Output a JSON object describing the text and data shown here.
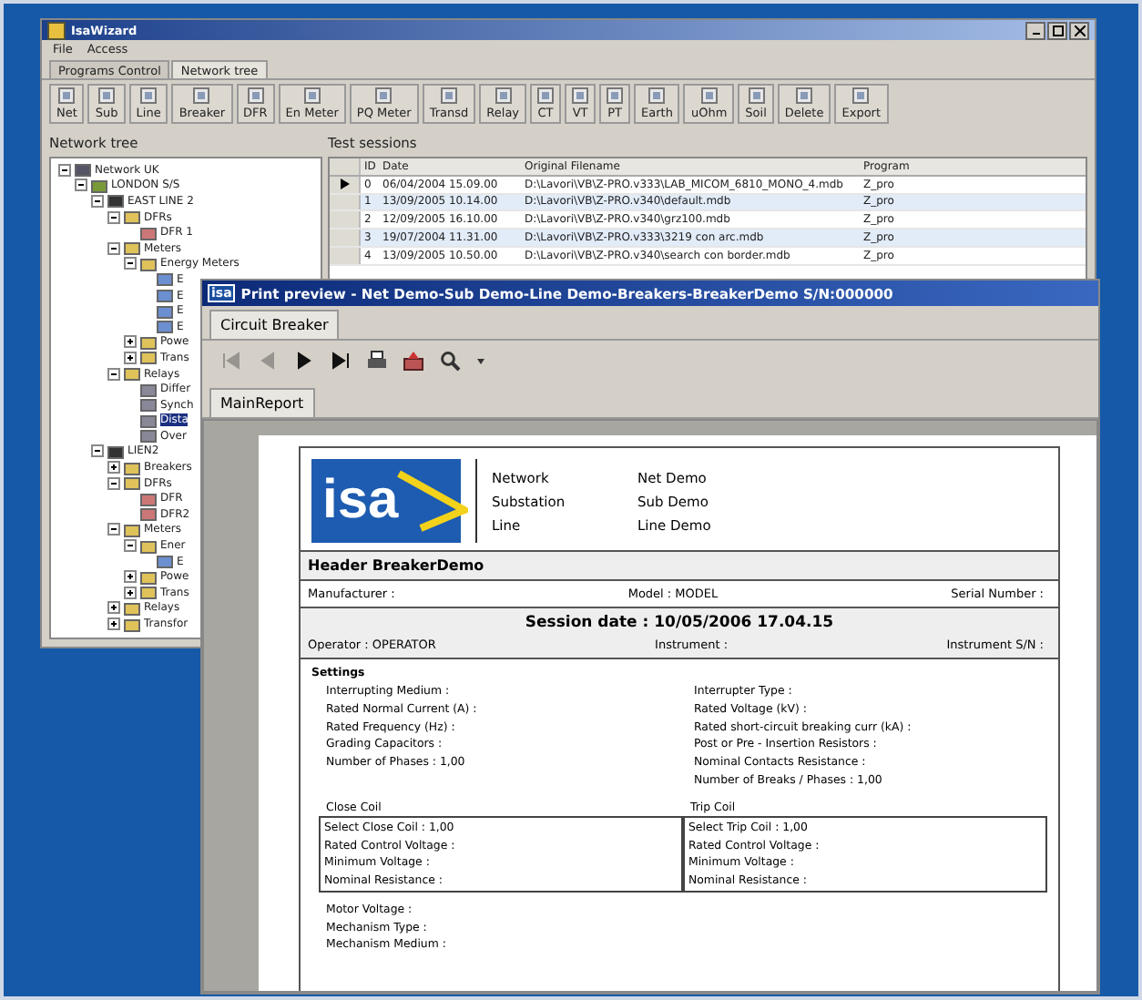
{
  "back_window": {
    "title": "IsaWizard",
    "menu": [
      "File",
      "Access"
    ],
    "tabs": [
      {
        "label": "Programs Control",
        "selected": false
      },
      {
        "label": "Network tree",
        "selected": true
      }
    ],
    "toolbar": [
      "Net",
      "Sub",
      "Line",
      "Breaker",
      "DFR",
      "En Meter",
      "PQ Meter",
      "Transd",
      "Relay",
      "CT",
      "VT",
      "PT",
      "Earth",
      "uOhm",
      "Soil",
      "Delete",
      "Export"
    ],
    "tree_panel": {
      "title": "Network tree",
      "items": [
        {
          "label": "Network UK",
          "kind": "network",
          "selected": false,
          "children": [
            {
              "label": "LONDON S/S",
              "kind": "substation",
              "selected": false,
              "children": [
                {
                  "label": "EAST LINE 2",
                  "kind": "line",
                  "selected": false,
                  "children": [
                    {
                      "label": "DFRs",
                      "kind": "folder",
                      "selected": false,
                      "children": [
                        {
                          "label": "DFR 1",
                          "kind": "dfr",
                          "selected": false
                        }
                      ]
                    },
                    {
                      "label": "Meters",
                      "kind": "folder",
                      "selected": false,
                      "children": [
                        {
                          "label": "Energy Meters",
                          "kind": "folder",
                          "selected": false,
                          "children": [
                            {
                              "label": "E",
                              "kind": "meter",
                              "selected": false
                            },
                            {
                              "label": "E",
                              "kind": "meter",
                              "selected": false
                            },
                            {
                              "label": "E",
                              "kind": "meter",
                              "selected": false
                            },
                            {
                              "label": "E",
                              "kind": "meter",
                              "selected": false
                            }
                          ]
                        },
                        {
                          "label": "Powe",
                          "kind": "folder",
                          "selected": false
                        },
                        {
                          "label": "Trans",
                          "kind": "folder",
                          "selected": false
                        }
                      ]
                    },
                    {
                      "label": "Relays",
                      "kind": "folder",
                      "selected": false,
                      "children": [
                        {
                          "label": "Differ",
                          "kind": "relay",
                          "selected": false
                        },
                        {
                          "label": "Synch",
                          "kind": "relay",
                          "selected": false
                        },
                        {
                          "label": "Dista",
                          "kind": "relay",
                          "selected": true
                        },
                        {
                          "label": "Over",
                          "kind": "relay",
                          "selected": false
                        }
                      ]
                    }
                  ]
                },
                {
                  "label": "LIEN2",
                  "kind": "line",
                  "selected": false,
                  "children": [
                    {
                      "label": "Breakers",
                      "kind": "folder",
                      "selected": false
                    },
                    {
                      "label": "DFRs",
                      "kind": "folder",
                      "selected": false,
                      "children": [
                        {
                          "label": "DFR",
                          "kind": "dfr",
                          "selected": false
                        },
                        {
                          "label": "DFR2",
                          "kind": "dfr",
                          "selected": false
                        }
                      ]
                    },
                    {
                      "label": "Meters",
                      "kind": "folder",
                      "selected": false,
                      "children": [
                        {
                          "label": "Ener",
                          "kind": "folder",
                          "selected": false,
                          "children": [
                            {
                              "label": "E",
                              "kind": "meter",
                              "selected": false
                            }
                          ]
                        },
                        {
                          "label": "Powe",
                          "kind": "folder",
                          "selected": false
                        },
                        {
                          "label": "Trans",
                          "kind": "folder",
                          "selected": false
                        }
                      ]
                    },
                    {
                      "label": "Relays",
                      "kind": "folder",
                      "selected": false
                    },
                    {
                      "label": "Transfor",
                      "kind": "folder",
                      "selected": false
                    }
                  ]
                }
              ]
            }
          ]
        }
      ]
    },
    "sessions_panel": {
      "title": "Test sessions",
      "columns": [
        "ID",
        "Date",
        "Original Filename",
        "Program"
      ],
      "rows": [
        {
          "current": true,
          "cells": [
            "0",
            "06/04/2004 15.09.00",
            "D:\\Lavori\\VB\\Z-PRO.v333\\LAB_MICOM_6810_MONO_4.mdb",
            "Z_pro"
          ]
        },
        {
          "current": false,
          "cells": [
            "1",
            "13/09/2005 10.14.00",
            "D:\\Lavori\\VB\\Z-PRO.v340\\default.mdb",
            "Z_pro"
          ]
        },
        {
          "current": false,
          "cells": [
            "2",
            "12/09/2005 16.10.00",
            "D:\\Lavori\\VB\\Z-PRO.v340\\grz100.mdb",
            "Z_pro"
          ]
        },
        {
          "current": false,
          "cells": [
            "3",
            "19/07/2004 11.31.00",
            "D:\\Lavori\\VB\\Z-PRO.v333\\3219 con arc.mdb",
            "Z_pro"
          ]
        },
        {
          "current": false,
          "cells": [
            "4",
            "13/09/2005 10.50.00",
            "D:\\Lavori\\VB\\Z-PRO.v340\\search con border.mdb",
            "Z_pro"
          ]
        }
      ]
    }
  },
  "front_window": {
    "title_icon": "isa",
    "title": "Print preview - Net Demo-Sub Demo-Line Demo-Breakers-BreakerDemo S/N:000000",
    "tabs": [
      "Circuit Breaker"
    ],
    "nav_buttons": [
      {
        "kind": "first",
        "disabled": true
      },
      {
        "kind": "previous",
        "disabled": true
      },
      {
        "kind": "next",
        "disabled": false
      },
      {
        "kind": "last",
        "disabled": false
      },
      {
        "kind": "print",
        "disabled": false
      },
      {
        "kind": "export",
        "disabled": false
      },
      {
        "kind": "zoom",
        "disabled": false
      },
      {
        "kind": "dropdown",
        "disabled": false
      }
    ],
    "report_tabs": [
      "MainReport"
    ],
    "report": {
      "logo": "isa",
      "info": [
        {
          "label": "Network",
          "value": "Net Demo"
        },
        {
          "label": "Substation",
          "value": "Sub Demo"
        },
        {
          "label": "Line",
          "value": "Line Demo"
        }
      ],
      "header": "Header BreakerDemo",
      "device_row": [
        "Manufacturer :",
        "Model : MODEL",
        "Serial Number :"
      ],
      "session_date": "Session date : 10/05/2006  17.04.15",
      "session_row": [
        "Operator : OPERATOR",
        "Instrument :",
        "Instrument S/N :"
      ],
      "settings_title": "Settings",
      "settings_left": [
        "Interrupting Medium :",
        "Rated Normal Current (A) :",
        "Rated Frequency (Hz) :",
        "Grading Capacitors :",
        "Number of Phases : 1,00"
      ],
      "settings_right": [
        "Interrupter Type :",
        "Rated Voltage (kV) :",
        "Rated short-circuit breaking curr (kA) :",
        "Post or Pre - Insertion Resistors :",
        "Nominal Contacts Resistance :",
        "Number of Breaks / Phases : 1,00"
      ],
      "coils": [
        {
          "title": "Close Coil",
          "lines": [
            "Select Close Coil : 1,00",
            "Rated Control Voltage :",
            "Minimum Voltage :",
            "Nominal Resistance :"
          ]
        },
        {
          "title": "Trip Coil",
          "lines": [
            "Select Trip Coil : 1,00",
            "Rated Control Voltage :",
            "Minimum Voltage :",
            "Nominal Resistance :"
          ]
        }
      ],
      "mechanism": [
        "Motor Voltage :",
        "Mechanism Type :",
        "Mechanism Medium :"
      ]
    }
  }
}
